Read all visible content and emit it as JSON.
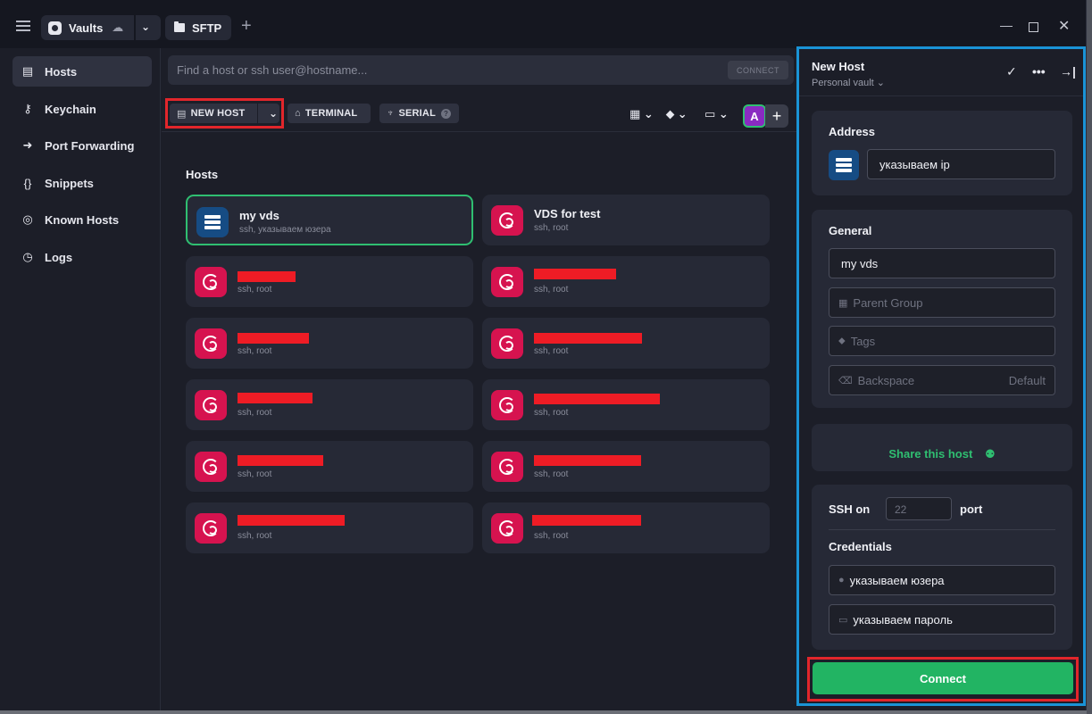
{
  "titlebar": {
    "vault_tab": "Vaults",
    "sftp_tab": "SFTP",
    "add_tab": "+"
  },
  "sidebar": {
    "items": [
      {
        "label": "Hosts",
        "icon": "hosts-icon"
      },
      {
        "label": "Keychain",
        "icon": "key-icon"
      },
      {
        "label": "Port Forwarding",
        "icon": "arrow-icon"
      },
      {
        "label": "Snippets",
        "icon": "braces-icon"
      },
      {
        "label": "Known Hosts",
        "icon": "fingerprint-icon"
      },
      {
        "label": "Logs",
        "icon": "clock-icon"
      }
    ]
  },
  "search": {
    "placeholder": "Find a host or ssh user@hostname...",
    "connect": "CONNECT"
  },
  "toolbar": {
    "new_host": "NEW HOST",
    "terminal": "TERMINAL",
    "serial": "SERIAL",
    "avatar": "A"
  },
  "hosts": {
    "title": "Hosts",
    "items": [
      {
        "title": "my vds",
        "sub": "ssh, указываем юзера"
      },
      {
        "title": "VDS for test",
        "sub": "ssh, root"
      },
      {
        "title": "",
        "sub": "ssh, root"
      },
      {
        "title": "",
        "sub": "ssh, root"
      },
      {
        "title": "",
        "sub": "ssh, root"
      },
      {
        "title": "",
        "sub": "ssh, root"
      },
      {
        "title": "",
        "sub": "ssh, root"
      },
      {
        "title": "",
        "sub": "ssh, root"
      },
      {
        "title": "",
        "sub": "ssh, root"
      },
      {
        "title": "",
        "sub": "ssh, root"
      },
      {
        "title": "",
        "sub": "ssh, root"
      },
      {
        "title": "",
        "sub": "ssh, root"
      }
    ]
  },
  "panel": {
    "title": "New Host",
    "vault": "Personal vault",
    "address_label": "Address",
    "address_value": "указываем ip",
    "general_label": "General",
    "label_value": "my vds",
    "parent_group_placeholder": "Parent Group",
    "tags_placeholder": "Tags",
    "backspace_placeholder": "Backspace",
    "backspace_default": "Default",
    "share": "Share this host",
    "ssh_on": "SSH on",
    "port_value": "22",
    "port_label": "port",
    "credentials_label": "Credentials",
    "username_value": "указываем юзера",
    "password_value": "указываем пароль",
    "connect": "Connect"
  },
  "colors": {
    "accent_green": "#22b463",
    "debian_red": "#d6134f",
    "panel_border": "#1a93d6",
    "highlight_red": "#e2262b"
  }
}
